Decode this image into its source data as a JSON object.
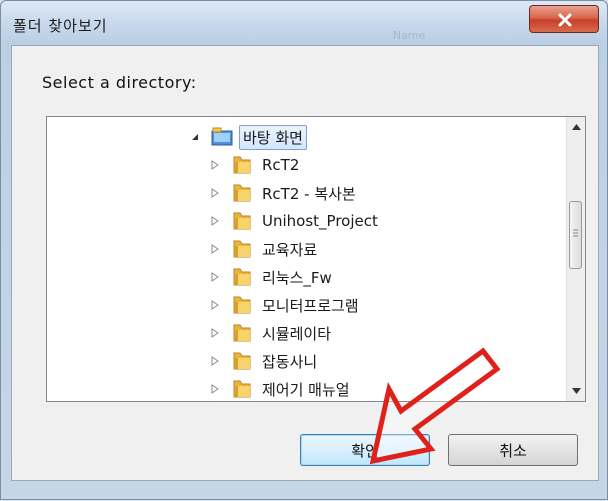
{
  "window": {
    "title": "폴더 찾아보기",
    "close_icon": "close-x-icon",
    "ghost_tab_text": "Name"
  },
  "dialog": {
    "prompt": "Select a directory:"
  },
  "tree": {
    "root": {
      "label": "바탕 화면",
      "expanded": true,
      "selected": true,
      "icon": "desktop-folder-icon"
    },
    "items": [
      {
        "label": "RcT2",
        "icon": "folder-icon"
      },
      {
        "label": "RcT2 - 복사본",
        "icon": "folder-icon"
      },
      {
        "label": "Unihost_Project",
        "icon": "folder-icon"
      },
      {
        "label": "교육자료",
        "icon": "folder-icon"
      },
      {
        "label": "리눅스_Fw",
        "icon": "folder-icon"
      },
      {
        "label": "모니터프로그램",
        "icon": "folder-icon"
      },
      {
        "label": "시뮬레이타",
        "icon": "folder-icon"
      },
      {
        "label": "잡동사니",
        "icon": "folder-icon"
      },
      {
        "label": "제어기 매뉴얼",
        "icon": "folder-icon"
      },
      {
        "label": "",
        "icon": "folder-icon"
      }
    ]
  },
  "buttons": {
    "ok_label": "확인",
    "cancel_label": "취소"
  },
  "colors": {
    "annotation_arrow": "#e0201a",
    "selection_fill": "#d3e6fb",
    "folder_yellow": "#f2c94c"
  }
}
